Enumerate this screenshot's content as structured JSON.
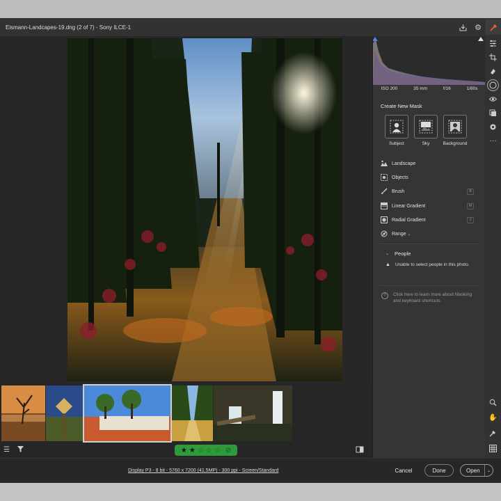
{
  "window": {
    "title": "Eismann-Landcapes-19.dng (2 of 7)  -  Sony ILCE-1"
  },
  "title_icons": [
    "save-icon",
    "gear-icon",
    "edit-icon"
  ],
  "exif": {
    "iso": "ISO 200",
    "focal": "35 mm",
    "aperture": "f/16",
    "shutter": "1/80s"
  },
  "masking": {
    "title": "Create New Mask",
    "quick_buttons": [
      {
        "label": "Subject",
        "icon": "subject-icon"
      },
      {
        "label": "Sky",
        "icon": "sky-icon"
      },
      {
        "label": "Background",
        "icon": "background-icon"
      }
    ],
    "tools": [
      {
        "label": "Landscape",
        "icon": "landscape-icon",
        "key": ""
      },
      {
        "label": "Objects",
        "icon": "objects-icon",
        "key": ""
      },
      {
        "label": "Brush",
        "icon": "brush-icon",
        "key": "B"
      },
      {
        "label": "Linear Gradient",
        "icon": "linear-gradient-icon",
        "key": "M"
      },
      {
        "label": "Radial Gradient",
        "icon": "radial-gradient-icon",
        "key": "J"
      },
      {
        "label": "Range",
        "icon": "range-icon",
        "key": ""
      }
    ],
    "people_title": "People",
    "people_warning": "Unable to select people in this photo.",
    "help_text": "Click here to learn more about Masking and keyboard shortcuts."
  },
  "filmstrip": {
    "count": 5,
    "selected_index": 2
  },
  "rating": {
    "value": 2,
    "max": 5
  },
  "footer": {
    "info": "Display P3 - 8 bit - 5760 x 7200 (41.5MP) - 300 ppi - Screen/Standard",
    "cancel": "Cancel",
    "done": "Done",
    "open": "Open"
  },
  "right_tools": [
    "edit-sliders-icon",
    "crop-icon",
    "heal-icon",
    "mask-icon",
    "red-eye-icon",
    "presets-icon",
    "snapshots-icon",
    "more-icon",
    "zoom-icon",
    "hand-icon",
    "sampler-icon",
    "grid-icon"
  ],
  "colors": {
    "rating_green": "#2f9a3a",
    "accent": "#f06040"
  }
}
